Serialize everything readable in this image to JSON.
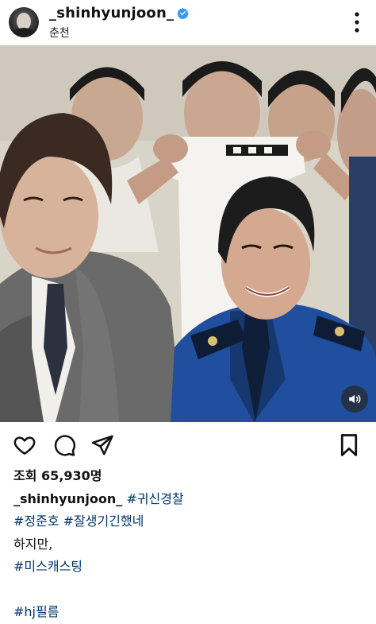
{
  "post": {
    "username": "_shinhyunjoon_",
    "location": "춘천"
  },
  "stats": {
    "views_label": "조회 65,930명"
  },
  "caption": {
    "author": "_shinhyunjoon_",
    "line1_tag": "#귀신경찰",
    "line2": "#정준호 #잘생기긴했네",
    "line3": "하지만,",
    "line4": "#미스캐스팅",
    "line5": "#hj필름"
  },
  "icons": {
    "verified": "verified-badge-icon",
    "more": "more-vertical-icon",
    "like": "heart-icon",
    "comment": "comment-icon",
    "share": "send-icon",
    "save": "bookmark-icon",
    "sound": "speaker-icon"
  },
  "colors": {
    "verified_blue": "#3897f0",
    "hashtag": "#00376b",
    "police_uniform": "#1f4f9e"
  }
}
